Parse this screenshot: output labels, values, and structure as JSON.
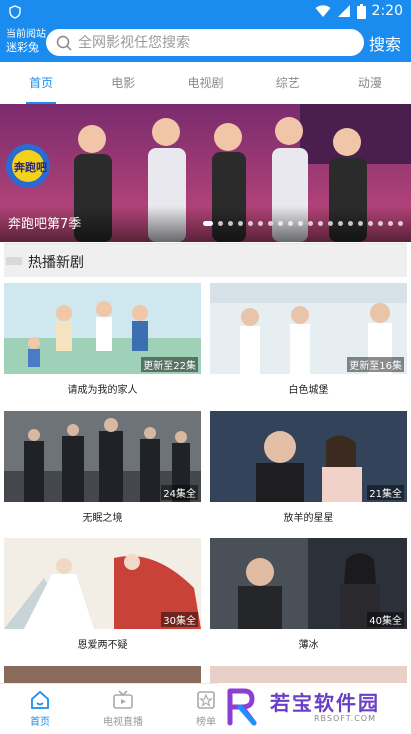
{
  "status_bar": {
    "time": "2:20"
  },
  "header": {
    "brand_line1": "当前阅站",
    "brand_line2": "迷彩兔",
    "search_placeholder": "全网影视任您搜索",
    "search_button": "搜索"
  },
  "tabs": [
    {
      "label": "首页",
      "active": true
    },
    {
      "label": "电影",
      "active": false
    },
    {
      "label": "电视剧",
      "active": false
    },
    {
      "label": "综艺",
      "active": false
    },
    {
      "label": "动漫",
      "active": false
    }
  ],
  "banner": {
    "caption": "奔跑吧第7季",
    "show_logo_text": "奔跑吧"
  },
  "section": {
    "title": "热播新剧"
  },
  "items": [
    {
      "title": "请成为我的家人",
      "badge": "更新至22集"
    },
    {
      "title": "白色城堡",
      "badge": "更新至16集"
    },
    {
      "title": "无眠之境",
      "badge": "24集全"
    },
    {
      "title": "放羊的星星",
      "badge": "21集全"
    },
    {
      "title": "恩爱两不疑",
      "badge": "30集全"
    },
    {
      "title": "薄冰",
      "badge": "40集全"
    }
  ],
  "bottom_nav": [
    {
      "label": "首页",
      "active": true,
      "icon": "home-icon"
    },
    {
      "label": "电视直播",
      "active": false,
      "icon": "tv-icon"
    },
    {
      "label": "榜单",
      "active": false,
      "icon": "star-icon"
    }
  ],
  "watermark": {
    "text": "若宝软件园",
    "sub": "RBSOFT.COM"
  },
  "colors": {
    "accent": "#1a8cf0"
  }
}
